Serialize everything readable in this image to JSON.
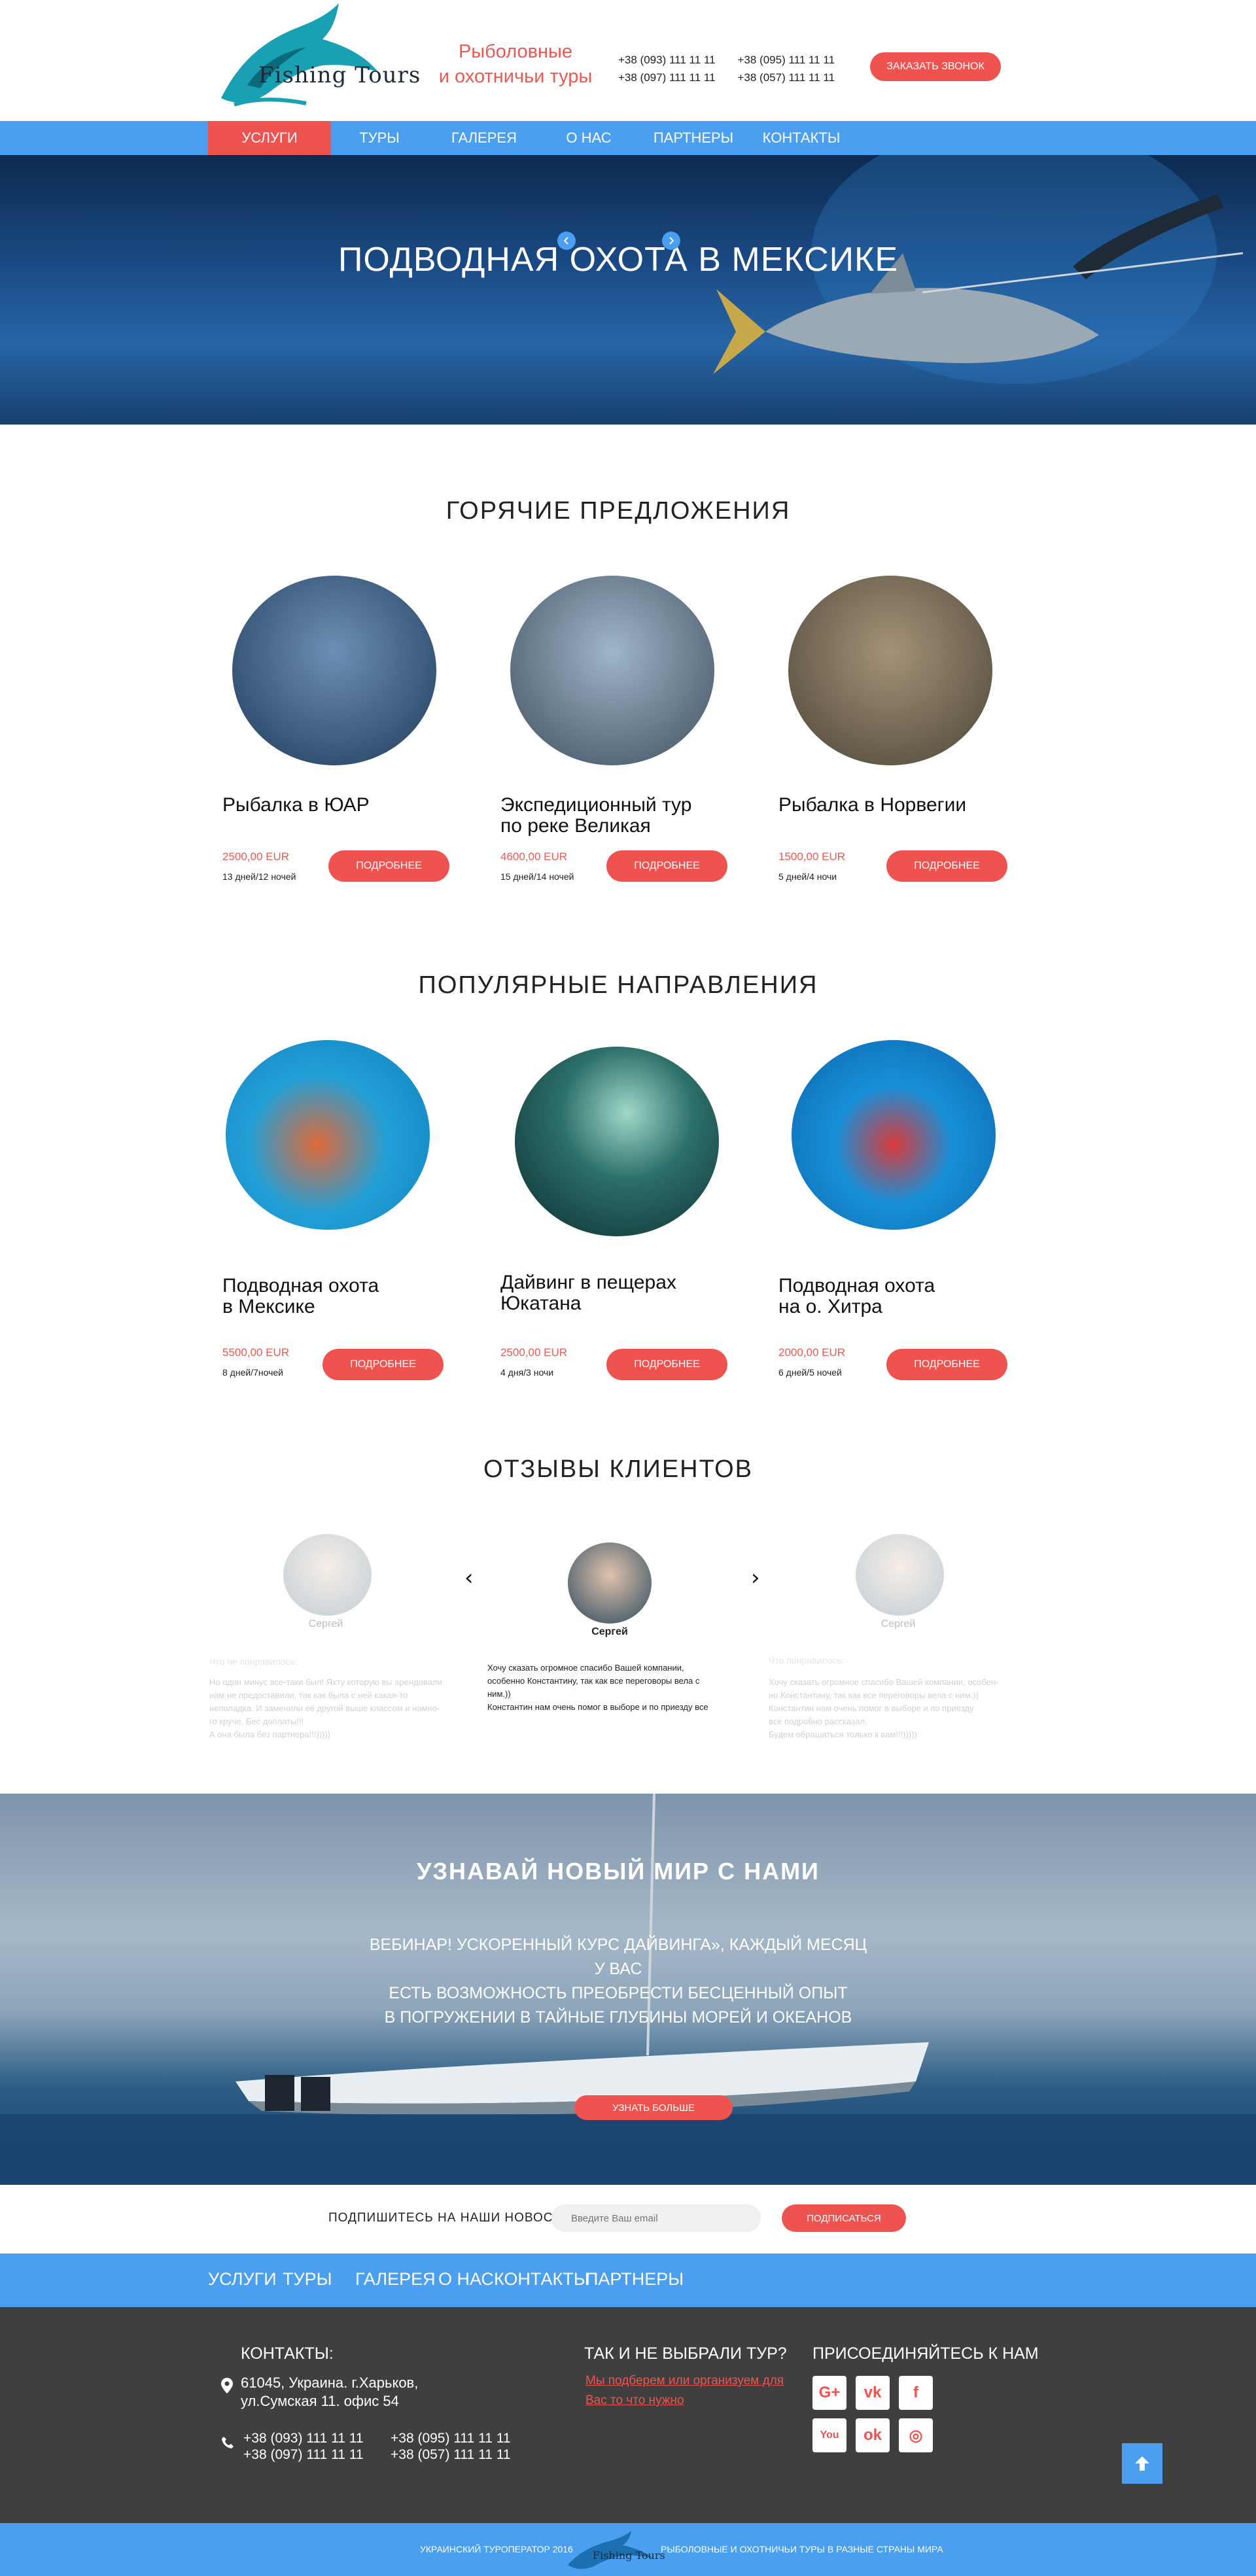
{
  "header": {
    "logo_text": "Fishing Tours",
    "tagline": "Рыболовные\nи охотничьи туры",
    "phones": [
      "+38 (093) 111 11 11",
      "+38 (095) 111 11 11",
      "+38 (097) 111 11 11",
      "+38 (057) 111 11 11"
    ],
    "callback_label": "ЗАКАЗАТЬ ЗВОНОК"
  },
  "nav": {
    "items": [
      "УСЛУГИ",
      "ТУРЫ",
      "ГАЛЕРЕЯ",
      "О НАС",
      "ПАРТНЕРЫ",
      "КОНТАКТЫ"
    ],
    "active": "УСЛУГИ"
  },
  "hero": {
    "title": "ПОДВОДНАЯ ОХОТА В МЕКСИКЕ",
    "prev_icon": "chevron-left-icon",
    "next_icon": "chevron-right-icon"
  },
  "hot_offers": {
    "title": "ГОРЯЧИЕ ПРЕДЛОЖЕНИЯ",
    "cards": [
      {
        "title": "Рыбалка в ЮАР",
        "price": "2500,00 EUR",
        "days": "13 дней/12 ночей",
        "button": "ПОДРОБНЕЕ"
      },
      {
        "title": "Экспедиционный тур\nпо реке Великая",
        "price": "4600,00 EUR",
        "days": "15 дней/14 ночей",
        "button": "ПОДРОБНЕЕ"
      },
      {
        "title": "Рыбалка в Норвегии",
        "price": "1500,00 EUR",
        "days": "5 дней/4 ночи",
        "button": "ПОДРОБНЕЕ"
      }
    ]
  },
  "popular": {
    "title": "ПОПУЛЯРНЫЕ НАПРАВЛЕНИЯ",
    "cards": [
      {
        "title": "Подводная охота\nв Мексике",
        "price": "5500,00 EUR",
        "days": "8 дней/7ночей",
        "button": "ПОДРОБНЕЕ"
      },
      {
        "title": "Дайвинг в пещерах\nЮкатана",
        "price": "2500,00 EUR",
        "days": "4 дня/3 ночи",
        "button": "ПОДРОБНЕЕ"
      },
      {
        "title": "Подводная охота\nна о. Хитра",
        "price": "2000,00 EUR",
        "days": "6 дней/5 ночей",
        "button": "ПОДРОБНЕЕ"
      }
    ]
  },
  "reviews": {
    "title": "ОТЗЫВЫ КЛИЕНТОВ",
    "items": [
      {
        "name": "Сергей",
        "heading": "Что не понравилось:",
        "text": "Но один минус все-таки был! Яхту которую вы арендовали\nнам не предоставили, так как была с ней какая-то\nнеполадка. И заменили её другой выше классом и намно-\nго круче. Бес доплаты!!!\nА она была без партнера!!!)))))"
      },
      {
        "name": "Сергей",
        "heading": "",
        "text": "Хочу сказать огромное спасибо Вашей компании,\nособенно Константину, так как все переговоры вела с\nним.))\nКонстантин нам очень помог в выборе и по приезду все"
      },
      {
        "name": "Сергей",
        "heading": "Что понравилось:",
        "text": "Хочу сказать огромное спасибо Вашей компании, особен-\nно Константину, так как все переговоры вела с ним.))\nКонстантин нам очень помог в выборе и по приезду\nвсе подробно рассказал.\nБудем обращаться только к вам!!!)))))"
      }
    ],
    "prev": "‹",
    "next": "›"
  },
  "promo": {
    "title": "УЗНАВАЙ НОВЫЙ МИР С НАМИ",
    "text": "ВЕБИНАР! УСКОРЕННЫЙ КУРС ДАЙВИНГА», КАЖДЫЙ МЕСЯЦ У ВАС\nЕСТЬ ВОЗМОЖНОСТЬ ПРЕОБРЕСТИ БЕСЦЕННЫЙ ОПЫТ\nВ ПОГРУЖЕНИИ  В  ТАЙНЫЕ ГЛУБИНЫ МОРЕЙ И ОКЕАНОВ",
    "button": "УЗНАТЬ БОЛЬШЕ"
  },
  "subscribe": {
    "label": "ПОДПИШИТЕСЬ НА НАШИ НОВОСТИ:",
    "placeholder": "Введите Ваш email",
    "button": "ПОДПИСАТЬСЯ"
  },
  "footer_nav": {
    "items": [
      "УСЛУГИ",
      "ТУРЫ",
      "ГАЛЕРЕЯ",
      "О НАС",
      "КОНТАКТЫ",
      "ПАРТНЕРЫ"
    ]
  },
  "footer": {
    "contacts_heading": "КОНТАКТЫ:",
    "address": "61045, Украина. г.Харьков,\nул.Сумская 11. офис 54",
    "phones": [
      "+38 (093) 111 11 11",
      "+38 (095) 111 11 11",
      "+38 (097) 111 11 11",
      "+38 (057) 111 11 11"
    ],
    "tour_heading": "ТАК И НЕ ВЫБРАЛИ ТУР?",
    "tour_link": "Мы подберем или организуем для\nВас то что нужно",
    "join_heading": "ПРИСОЕДИНЯЙТЕСЬ К НАМ",
    "socials": [
      {
        "icon": "google-plus-icon",
        "glyph": "G+"
      },
      {
        "icon": "vk-icon",
        "glyph": "vk"
      },
      {
        "icon": "facebook-icon",
        "glyph": "f"
      },
      {
        "icon": "youtube-icon",
        "glyph": "You"
      },
      {
        "icon": "odnoklassniki-icon",
        "glyph": "ok"
      },
      {
        "icon": "instagram-icon",
        "glyph": "◎"
      }
    ],
    "to_top_icon": "arrow-up-icon"
  },
  "bottom_bar": {
    "left": "УКРАИНСКИЙ ТУРОПЕРАТОР 2016",
    "logo_text": "Fishing Tours",
    "right": "РЫБОЛОВНЫЕ И ОХОТНИЧЬИ ТУРЫ В РАЗНЫЕ СТРАНЫ МИРА"
  },
  "colors": {
    "accent_red": "#ef5350",
    "nav_blue": "#4a9ff0",
    "footer_dark": "#3f3f3f"
  }
}
